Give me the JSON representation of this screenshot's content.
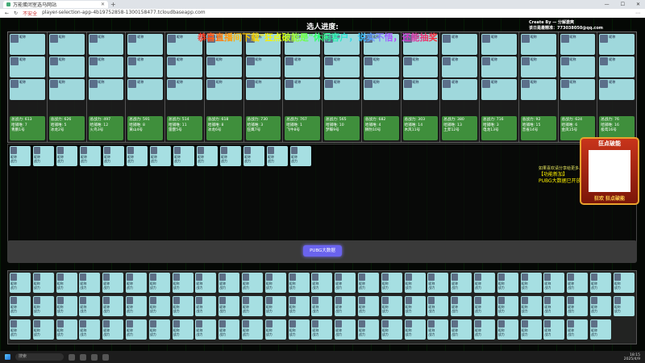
{
  "browser": {
    "tab_title": "万能蛋闭室选马网站",
    "new_tab": "+",
    "security_label": "不安全",
    "url": "player-selection-app-4b19752858-1300158477.tcloudbaseapp.com",
    "window_buttons": [
      "—",
      "☐",
      "✕"
    ]
  },
  "page": {
    "title": "选人进度:",
    "banner": "恭喜直播间下载\"狂点破能是\"休闲客户，说实不悟，还能抽奖",
    "credit_line1": "Create By — 分解激爽",
    "credit_line2": "该日是最精准：773038050@qq.com"
  },
  "teams": [
    {
      "power": "总战力: 613",
      "kills": "哈捕唯: 7",
      "name": "青鹏1号"
    },
    {
      "power": "总战力: 626",
      "kills": "哈捕唯: 5",
      "name": "冰龙2号"
    },
    {
      "power": "总战力: 497",
      "kills": "哈捕唯: 12",
      "name": "火鸟3号"
    },
    {
      "power": "总战力: 591",
      "kills": "哈捕唯: 8",
      "name": "黄山4号"
    },
    {
      "power": "总战力: 514",
      "kills": "哈捕唯: 11",
      "name": "雷霆5号"
    },
    {
      "power": "总战力: 618",
      "kills": "哈捕唯: 8",
      "name": "冰龙6号"
    },
    {
      "power": "总战力: 730",
      "kills": "哈捕唯: 3",
      "name": "狂鹰7号"
    },
    {
      "power": "总战力: 767",
      "kills": "哈捕唯: 1",
      "name": "飞牛8号"
    },
    {
      "power": "总战力: 565",
      "kills": "哈捕唯: 10",
      "name": "梦蝶9号"
    },
    {
      "power": "总战力: 682",
      "kills": "哈捕唯: 4",
      "name": "狮豹10号"
    },
    {
      "power": "总战力: 303",
      "kills": "哈捕唯: 14",
      "name": "木风11号"
    },
    {
      "power": "总战力: 380",
      "kills": "哈捕唯: 13",
      "name": "土斧12号"
    },
    {
      "power": "总战力: 716",
      "kills": "哈捕唯: 3",
      "name": "电龙13号"
    },
    {
      "power": "总战力: 92",
      "kills": "哈捕唯: 15",
      "name": "音雀14号"
    },
    {
      "power": "总战力: 624",
      "kills": "哈捕唯: 6",
      "name": "金凤15号"
    },
    {
      "power": "总战力: 76",
      "kills": "哈捕唯: 16",
      "name": "极鸾16号"
    }
  ],
  "player_card": {
    "label": "昵称",
    "power_label": "战力"
  },
  "news": {
    "line1": "如果喜欢请分享给更多人~",
    "heading": "【功能新加】",
    "line2": "PUBG大数据已开放"
  },
  "qr_promo": {
    "heading": "狂点破能",
    "footer": "狂欢 狂点破能"
  },
  "action_button": "PUBG大数据",
  "taskbar": {
    "search": "搜索",
    "time": "18:15",
    "date": "2025/4/9"
  }
}
